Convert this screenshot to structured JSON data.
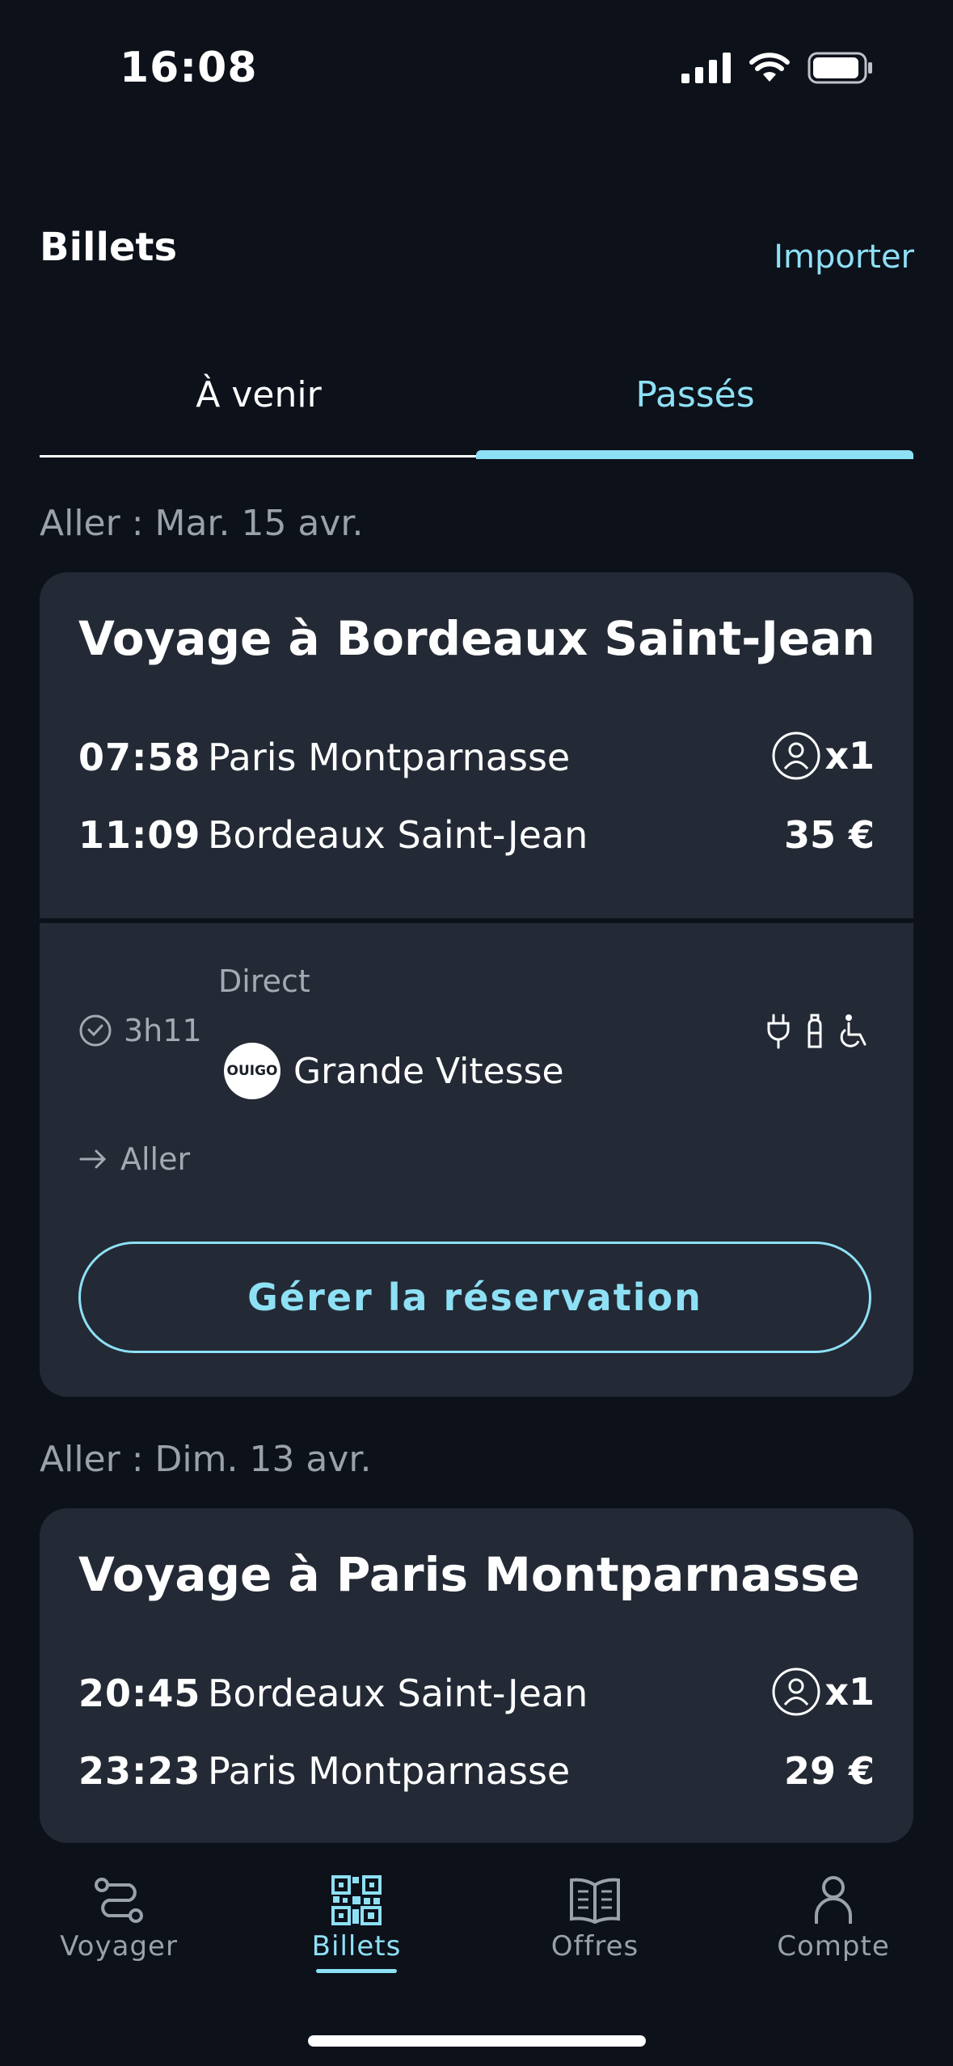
{
  "status_bar": {
    "time": "16:08"
  },
  "header": {
    "title": "Billets",
    "import_label": "Importer"
  },
  "tabs": [
    {
      "label": "À venir",
      "active": false
    },
    {
      "label": "Passés",
      "active": true
    }
  ],
  "trips": [
    {
      "section_label": "Aller : Mar. 15 avr.",
      "title": "Voyage à Bordeaux Saint-Jean",
      "departure_time": "07:58",
      "departure_station": "Paris Montparnasse",
      "arrival_time": "11:09",
      "arrival_station": "Bordeaux Saint-Jean",
      "passengers": "x1",
      "price": "35 €",
      "duration": "3h11",
      "connection": "Direct",
      "operator_logo": "OUIGO",
      "operator_name": "Grande Vitesse",
      "amenities": [
        "power-plug-icon",
        "bottle-icon",
        "wheelchair-icon"
      ],
      "direction": "Aller",
      "manage_button": "Gérer la réservation"
    },
    {
      "section_label": "Aller : Dim. 13 avr.",
      "title": "Voyage à Paris Montparnasse",
      "departure_time": "20:45",
      "departure_station": "Bordeaux Saint-Jean",
      "arrival_time": "23:23",
      "arrival_station": "Paris Montparnasse",
      "passengers": "x1",
      "price": "29 €"
    }
  ],
  "bottom_nav": [
    {
      "label": "Voyager",
      "icon": "route-icon",
      "active": false
    },
    {
      "label": "Billets",
      "icon": "qr-code-icon",
      "active": true
    },
    {
      "label": "Offres",
      "icon": "open-book-icon",
      "active": false
    },
    {
      "label": "Compte",
      "icon": "person-icon",
      "active": false
    }
  ],
  "colors": {
    "background": "#0c111a",
    "card": "#232a35",
    "accent": "#8ee0f5",
    "muted": "#9aa1ab"
  }
}
